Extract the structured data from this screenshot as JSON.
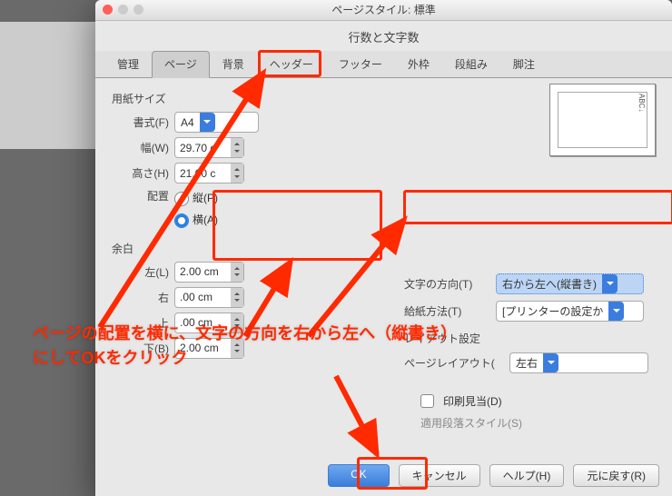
{
  "window": {
    "title": "ページスタイル: 標準",
    "subtitle": "行数と文字数"
  },
  "tabs": [
    "管理",
    "ページ",
    "背景",
    "ヘッダー",
    "フッター",
    "外枠",
    "段組み",
    "脚注"
  ],
  "activeTab": "ページ",
  "paper": {
    "section": "用紙サイズ",
    "format_label": "書式(F)",
    "format_value": "A4",
    "width_label": "幅(W)",
    "width_value": "29.70 c",
    "height_label": "高さ(H)",
    "height_value": "21.00 c",
    "orient_label": "配置",
    "portrait": "縦(P)",
    "landscape": "横(A)"
  },
  "margins": {
    "section": "余白",
    "left_label": "左(L)",
    "left_value": "2.00 cm",
    "right_label": "右",
    "right_value": ".00 cm",
    "top_label": "上",
    "top_value": ".00 cm",
    "bottom_label": "下(B)",
    "bottom_value": "2.00 cm"
  },
  "right": {
    "textdir_label": "文字の方向(T)",
    "textdir_value": "右から左へ(縦書き)",
    "tray_label": "給紙方法(T)",
    "tray_value": "[プリンターの設定か",
    "layout_section": "レイアウト設定",
    "pagelayout_label": "ページレイアウト(",
    "pagelayout_value": "左右",
    "printview_label": "印刷見当(D)",
    "parastyle_label": "適用段落スタイル(S)"
  },
  "preview_text": "ABC↓",
  "buttons": {
    "ok": "OK",
    "cancel": "キャンセル",
    "help": "ヘルプ(H)",
    "reset": "元に戻す(R)"
  },
  "annotation": {
    "line1": "ページの配置を横に、文字の方向を右から左へ（縦書き）",
    "line2": "にしてOKをクリック"
  }
}
